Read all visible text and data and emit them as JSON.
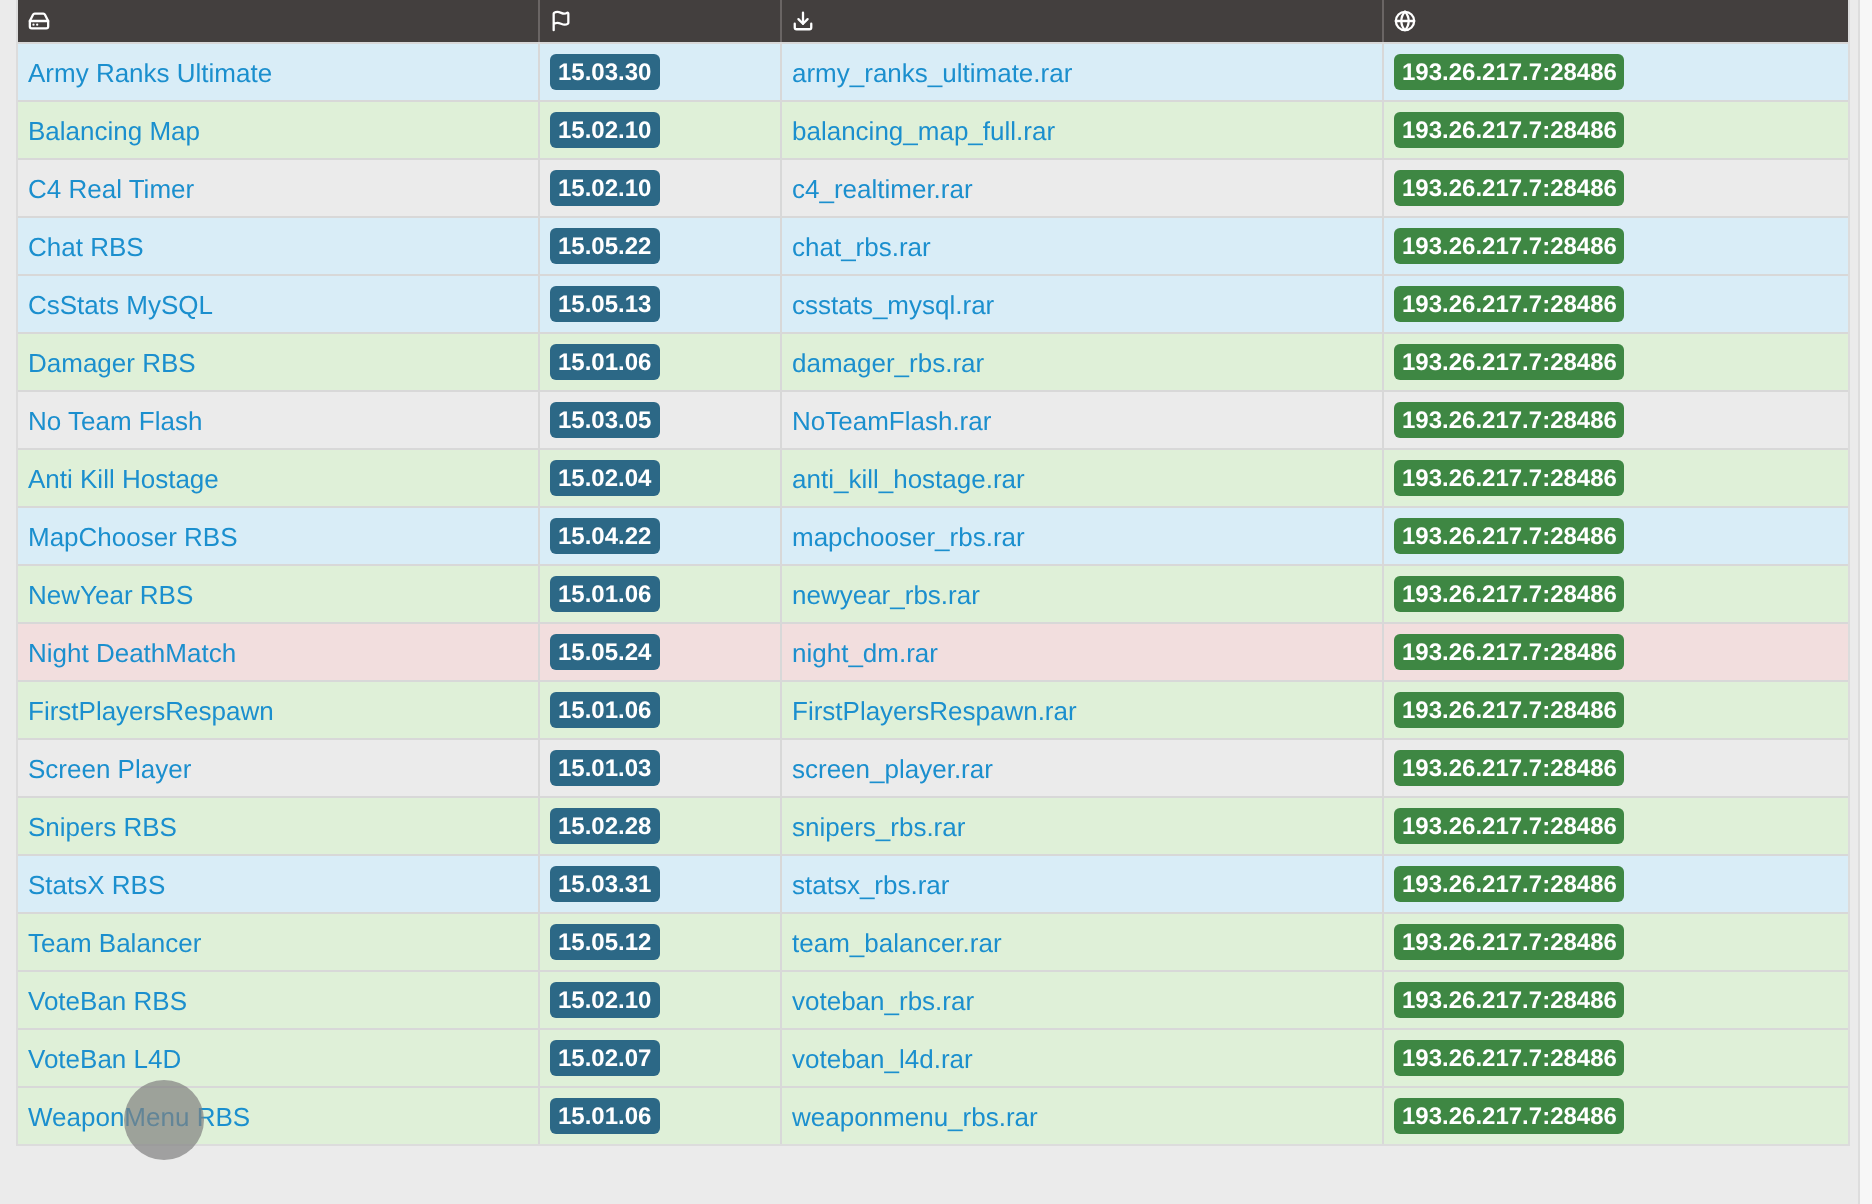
{
  "table": {
    "rows": [
      {
        "name": "Army Ranks Ultimate",
        "version": "15.03.30",
        "file": "army_ranks_ultimate.rar",
        "server": "193.26.217.7:28486",
        "color": "#d9edf7"
      },
      {
        "name": "Balancing Map",
        "version": "15.02.10",
        "file": "balancing_map_full.rar",
        "server": "193.26.217.7:28486",
        "color": "#dff0d8"
      },
      {
        "name": "C4 Real Timer",
        "version": "15.02.10",
        "file": "c4_realtimer.rar",
        "server": "193.26.217.7:28486",
        "color": "#ebebeb"
      },
      {
        "name": "Chat RBS",
        "version": "15.05.22",
        "file": "chat_rbs.rar",
        "server": "193.26.217.7:28486",
        "color": "#d9edf7"
      },
      {
        "name": "CsStats MySQL",
        "version": "15.05.13",
        "file": "csstats_mysql.rar",
        "server": "193.26.217.7:28486",
        "color": "#d9edf7"
      },
      {
        "name": "Damager RBS",
        "version": "15.01.06",
        "file": "damager_rbs.rar",
        "server": "193.26.217.7:28486",
        "color": "#dff0d8"
      },
      {
        "name": "No Team Flash",
        "version": "15.03.05",
        "file": "NoTeamFlash.rar",
        "server": "193.26.217.7:28486",
        "color": "#ebebeb"
      },
      {
        "name": "Anti Kill Hostage",
        "version": "15.02.04",
        "file": "anti_kill_hostage.rar",
        "server": "193.26.217.7:28486",
        "color": "#dff0d8"
      },
      {
        "name": "MapChooser RBS",
        "version": "15.04.22",
        "file": "mapchooser_rbs.rar",
        "server": "193.26.217.7:28486",
        "color": "#d9edf7"
      },
      {
        "name": "NewYear RBS",
        "version": "15.01.06",
        "file": "newyear_rbs.rar",
        "server": "193.26.217.7:28486",
        "color": "#dff0d8"
      },
      {
        "name": "Night DeathMatch",
        "version": "15.05.24",
        "file": "night_dm.rar",
        "server": "193.26.217.7:28486",
        "color": "#f2dede"
      },
      {
        "name": "FirstPlayersRespawn",
        "version": "15.01.06",
        "file": "FirstPlayersRespawn.rar",
        "server": "193.26.217.7:28486",
        "color": "#dff0d8"
      },
      {
        "name": "Screen Player",
        "version": "15.01.03",
        "file": "screen_player.rar",
        "server": "193.26.217.7:28486",
        "color": "#ebebeb"
      },
      {
        "name": "Snipers RBS",
        "version": "15.02.28",
        "file": "snipers_rbs.rar",
        "server": "193.26.217.7:28486",
        "color": "#dff0d8"
      },
      {
        "name": "StatsX RBS",
        "version": "15.03.31",
        "file": "statsx_rbs.rar",
        "server": "193.26.217.7:28486",
        "color": "#d9edf7"
      },
      {
        "name": "Team Balancer",
        "version": "15.05.12",
        "file": "team_balancer.rar",
        "server": "193.26.217.7:28486",
        "color": "#dff0d8"
      },
      {
        "name": "VoteBan RBS",
        "version": "15.02.10",
        "file": "voteban_rbs.rar",
        "server": "193.26.217.7:28486",
        "color": "#dff0d8"
      },
      {
        "name": "VoteBan L4D",
        "version": "15.02.07",
        "file": "voteban_l4d.rar",
        "server": "193.26.217.7:28486",
        "color": "#dff0d8"
      },
      {
        "name": "WeaponMenu RBS",
        "version": "15.01.06",
        "file": "weaponmenu_rbs.rar",
        "server": "193.26.217.7:28486",
        "color": "#dff0d8"
      }
    ]
  }
}
